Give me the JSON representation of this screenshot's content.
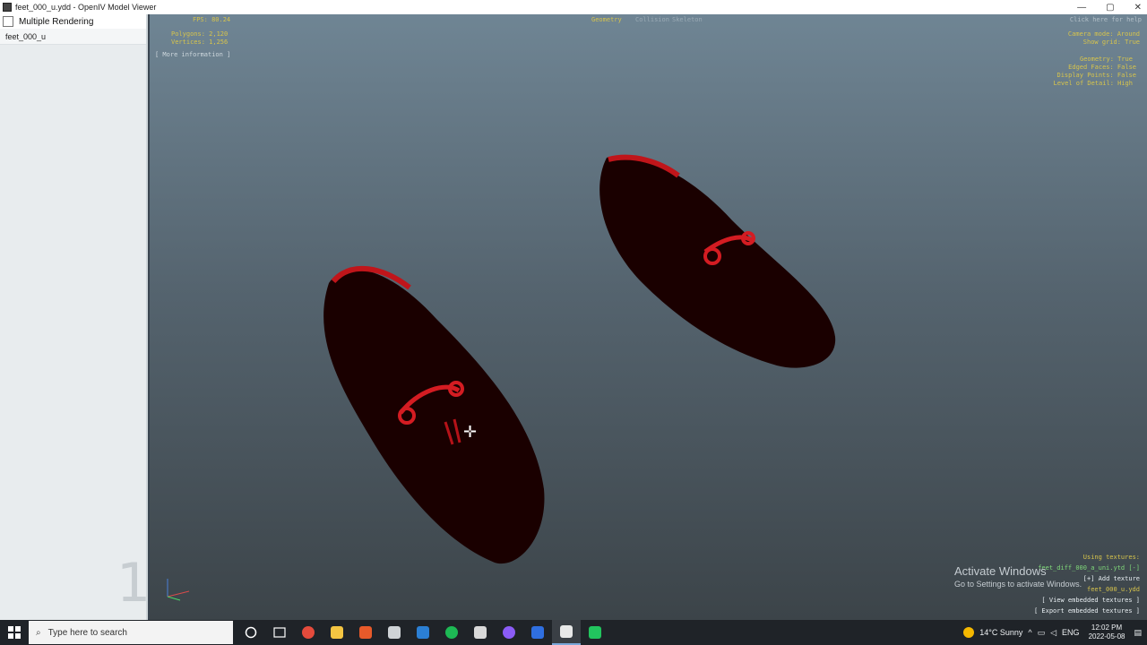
{
  "window": {
    "title": "feet_000_u.ydd - OpenIV Model Viewer",
    "controls": [
      "—",
      "▢",
      "✕"
    ]
  },
  "sidebar": {
    "multiple_rendering_label": "Multiple Rendering",
    "items": [
      {
        "label": "feet_000_u"
      }
    ],
    "corner_number": "1"
  },
  "hud": {
    "fps": "FPS: 80.24",
    "polygons": "Polygons: 2,120",
    "vertices": "Vertices: 1,256",
    "more_info": "[ More information ]",
    "tabs": [
      "Geometry",
      "Collision",
      "Skeleton"
    ],
    "help": "Click here for help",
    "camera_mode": "Camera mode: Around",
    "show_grid": "Show grid: True",
    "geometry": "Geometry: True",
    "edged_faces": "Edged Faces: False",
    "display_points": "Display Points: False",
    "level_of_detail": "Level of Detail: High",
    "using_textures": "Using textures:",
    "texture_file": "feet_diff_000_a_uni.ytd [-]",
    "add_texture": "[+] Add texture",
    "ydd_file": "feet_000_u.ydd",
    "view_embedded": "[ View embedded textures ]",
    "export_embedded": "[ Export embedded textures ]"
  },
  "activation": {
    "title": "Activate Windows",
    "subtitle": "Go to Settings to activate Windows."
  },
  "taskbar": {
    "search_placeholder": "Type here to search",
    "weather": "14°C  Sunny",
    "language": "ENG",
    "time": "12:02 PM",
    "date": "2022-05-08",
    "app_colors": [
      "#e54b3c",
      "#f4c542",
      "#e85a2a",
      "#cfd3d6",
      "#2b7fd4",
      "#1db954",
      "#d9d9d9",
      "#8b5cf6",
      "#2f6fe0",
      "#e8e8e8",
      "#22c55e"
    ]
  }
}
